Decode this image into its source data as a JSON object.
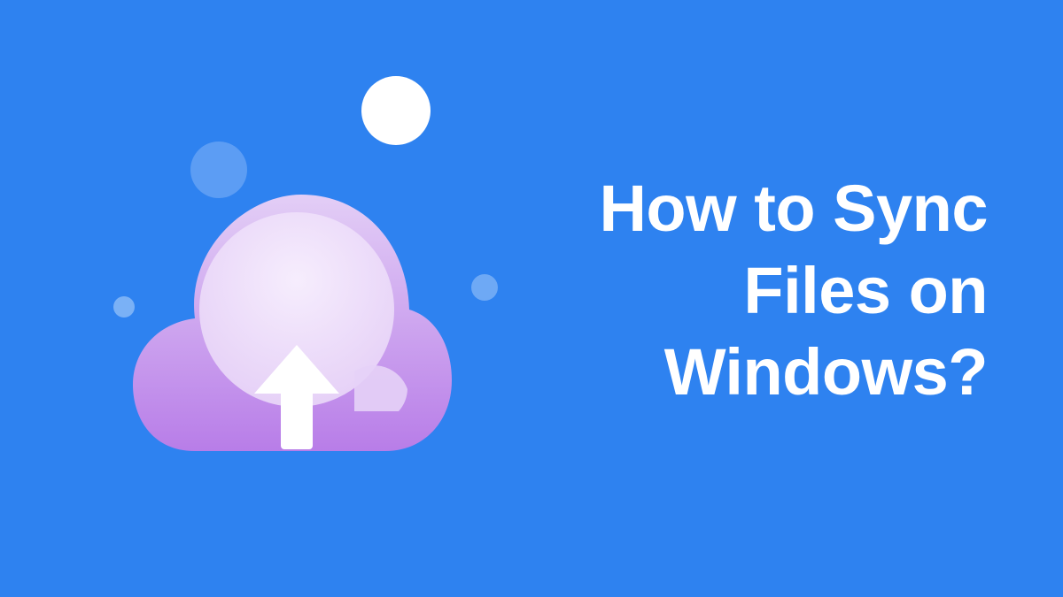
{
  "background_color": "#2e82f0",
  "heading": "How to Sync Files on Windows?",
  "icon_name": "cloud-upload-icon",
  "icon_colors": {
    "cloud_outer_top": "#dcc3f3",
    "cloud_outer_bottom": "#b87de8",
    "cloud_inner": "#efe2fb",
    "arrow": "#ffffff"
  },
  "dots": [
    {
      "name": "dot-white-large",
      "color": "#ffffff"
    },
    {
      "name": "dot-blue-medium",
      "color": "#5c9df4"
    },
    {
      "name": "dot-blue-small-left",
      "color": "#7ab1f6"
    },
    {
      "name": "dot-blue-small-right",
      "color": "#6ea9f5"
    }
  ]
}
